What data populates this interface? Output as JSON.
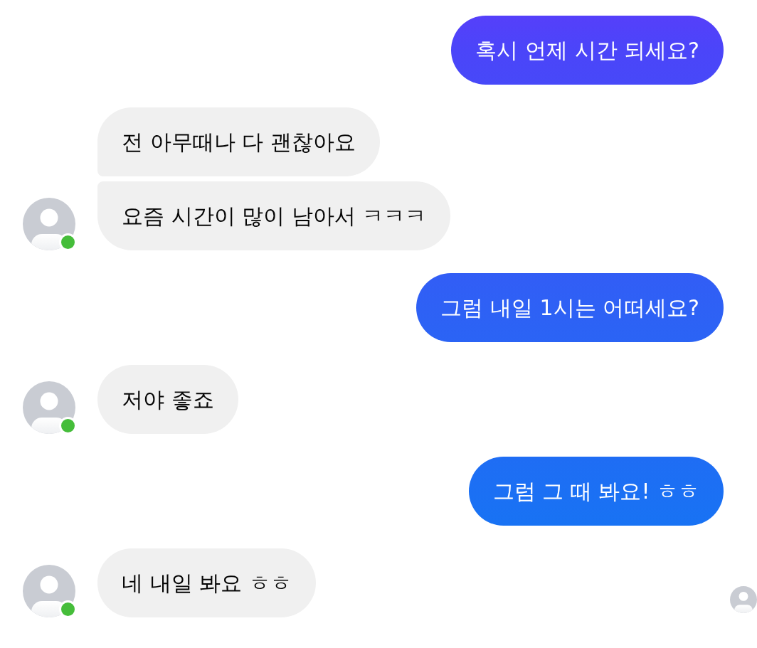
{
  "conversation": {
    "groups": [
      {
        "kind": "sent",
        "messages": [
          "혹시 언제 시간 되세요?"
        ]
      },
      {
        "kind": "received",
        "online": true,
        "messages": [
          "전 아무때나 다 괜찮아요",
          "요즘 시간이 많이 남아서 ㅋㅋㅋ"
        ]
      },
      {
        "kind": "sent",
        "messages": [
          "그럼 내일 1시는 어떠세요?"
        ]
      },
      {
        "kind": "received",
        "online": true,
        "messages": [
          "저야 좋죠"
        ]
      },
      {
        "kind": "sent",
        "messages": [
          "그럼 그 때 봐요! ㅎㅎ"
        ]
      },
      {
        "kind": "received",
        "online": true,
        "messages": [
          "네 내일 봐요 ㅎㅎ"
        ]
      }
    ],
    "seen": true
  }
}
